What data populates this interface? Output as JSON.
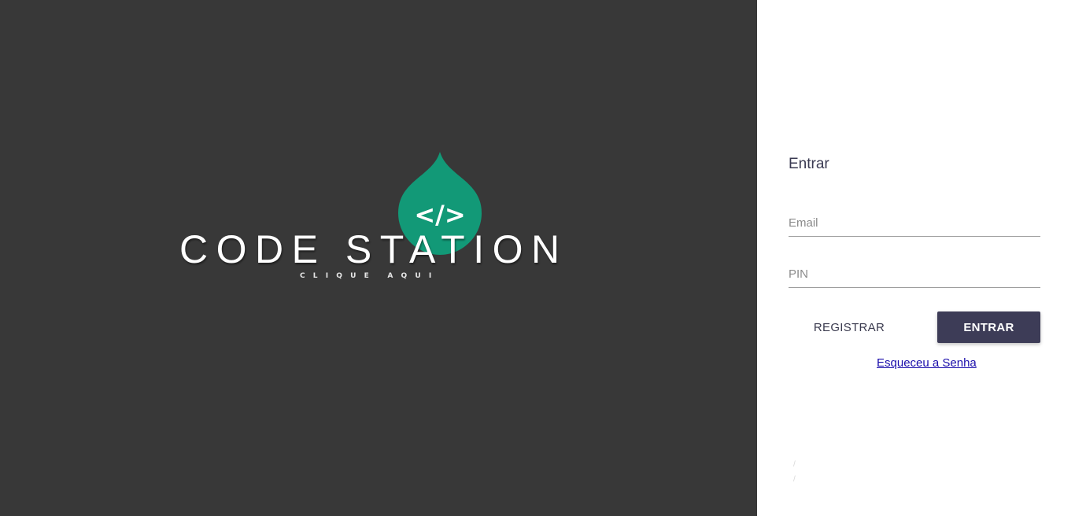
{
  "brand": {
    "title": "CODE STATION",
    "subtitle": "CLIQUE AQUI",
    "code_glyph": "</>",
    "accent_color": "#129977",
    "background_color": "#383838"
  },
  "login": {
    "title": "Entrar",
    "email_placeholder": "Email",
    "pin_placeholder": "PIN",
    "register_label": "REGISTRAR",
    "enter_label": "ENTRAR",
    "forgot_label": "Esqueceu a Senha",
    "button_color": "#3d3c57"
  }
}
